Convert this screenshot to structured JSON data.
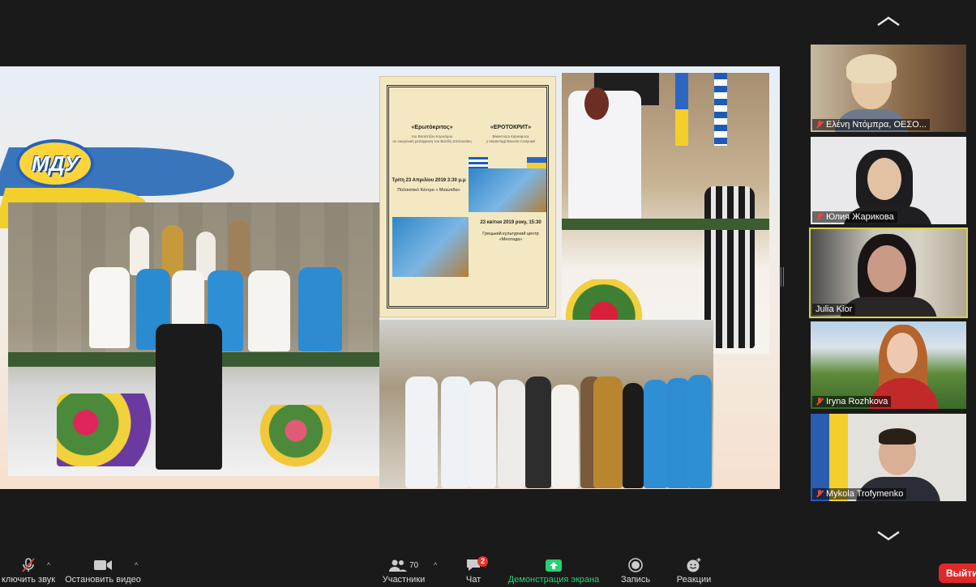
{
  "shared_screen": {
    "logo_text": "МДУ",
    "poster": {
      "title_left": "«Ερωτόκριτος»",
      "sub_left": "του Βιτσέντζου Κορνάρου\nσε ουκρανική μετάφραση του Βασίλη Σαπουνάκη",
      "title_right": "«ЕРОТОКРИТ»",
      "sub_right": "Вікентіоса Корнароса\nу перекладі Василя Сапунакі",
      "date_left": "Τρίτη 23 Απριλίου 2019 3:30 μ.μ",
      "venue_left": "Πολιτιστικό Κέντρο « Μαιώτιδα»",
      "date_right": "23 квітня 2019 року, 15:30",
      "venue_right": "Грецький культурний центр «Меотида»"
    }
  },
  "participants": [
    {
      "name": "Ελένη Ντόμπρα, ΟΕΣΟ...",
      "muted": true,
      "active": false
    },
    {
      "name": "Юлия Жарикова",
      "muted": true,
      "active": false
    },
    {
      "name": "Julia Kior",
      "muted": false,
      "active": true
    },
    {
      "name": "Iryna Rozhkova",
      "muted": true,
      "active": false
    },
    {
      "name": "Mykola Trofymenko",
      "muted": true,
      "active": false
    }
  ],
  "toolbar": {
    "mute_label": "ключить звук",
    "video_label": "Остановить видео",
    "participants_count": "70",
    "participants_label": "Участники",
    "chat_label": "Чат",
    "chat_badge": "2",
    "share_label": "Демонстрация экрана",
    "record_label": "Запись",
    "reactions_label": "Реакции",
    "leave_label": "Выйти"
  },
  "colors": {
    "accent_green": "#24d172",
    "leave_red": "#e02828",
    "active_border": "#d6d24b"
  }
}
